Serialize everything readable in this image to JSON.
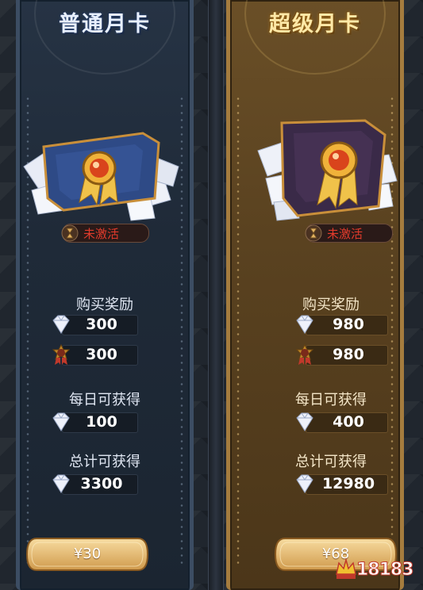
{
  "cards": [
    {
      "title": "普通月卡",
      "status": "未激活",
      "purchase_reward_label": "购买奖励",
      "purchase_diamonds": "300",
      "purchase_vip": "300",
      "daily_label": "每日可获得",
      "daily_diamonds": "100",
      "total_label": "总计可获得",
      "total_diamonds": "3300",
      "price": "¥30"
    },
    {
      "title": "超级月卡",
      "status": "未激活",
      "purchase_reward_label": "购买奖励",
      "purchase_diamonds": "980",
      "purchase_vip": "980",
      "daily_label": "每日可获得",
      "daily_diamonds": "400",
      "total_label": "总计可获得",
      "total_diamonds": "12980",
      "price": "¥68"
    }
  ],
  "watermark": "18183",
  "colors": {
    "status_red": "#e23b2c",
    "normal_accent": "#3c4d63",
    "super_accent": "#a57c3e"
  },
  "icons": [
    "diamond-icon",
    "vip-medal-icon",
    "hourglass-icon",
    "card-medal-icon"
  ]
}
